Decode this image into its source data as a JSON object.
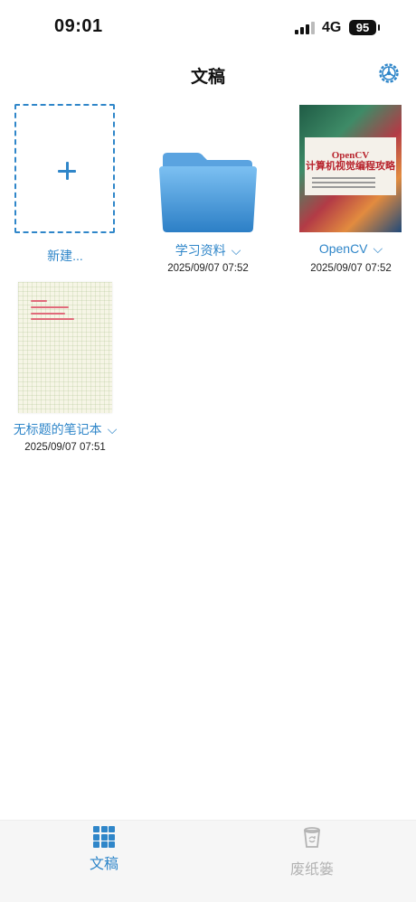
{
  "status_bar": {
    "time": "09:01",
    "network": "4G",
    "battery": "95"
  },
  "nav": {
    "title": "文稿",
    "settings_icon": "gear-icon"
  },
  "colors": {
    "accent": "#2f86c9",
    "inactive": "#b3b3b3"
  },
  "items": [
    {
      "kind": "new",
      "label": "新建..."
    },
    {
      "kind": "folder",
      "label": "学习资料",
      "date": "2025/09/07 07:52"
    },
    {
      "kind": "book",
      "label": "OpenCV",
      "date": "2025/09/07 07:52",
      "cover_title": "OpenCV\n计算机视觉编程攻略"
    },
    {
      "kind": "notebook",
      "label": "无标题的笔记本",
      "date": "2025/09/07 07:51"
    }
  ],
  "tabs": [
    {
      "label": "文稿",
      "active": true,
      "icon": "grid-icon"
    },
    {
      "label": "废纸篓",
      "active": false,
      "icon": "trash-icon"
    }
  ]
}
